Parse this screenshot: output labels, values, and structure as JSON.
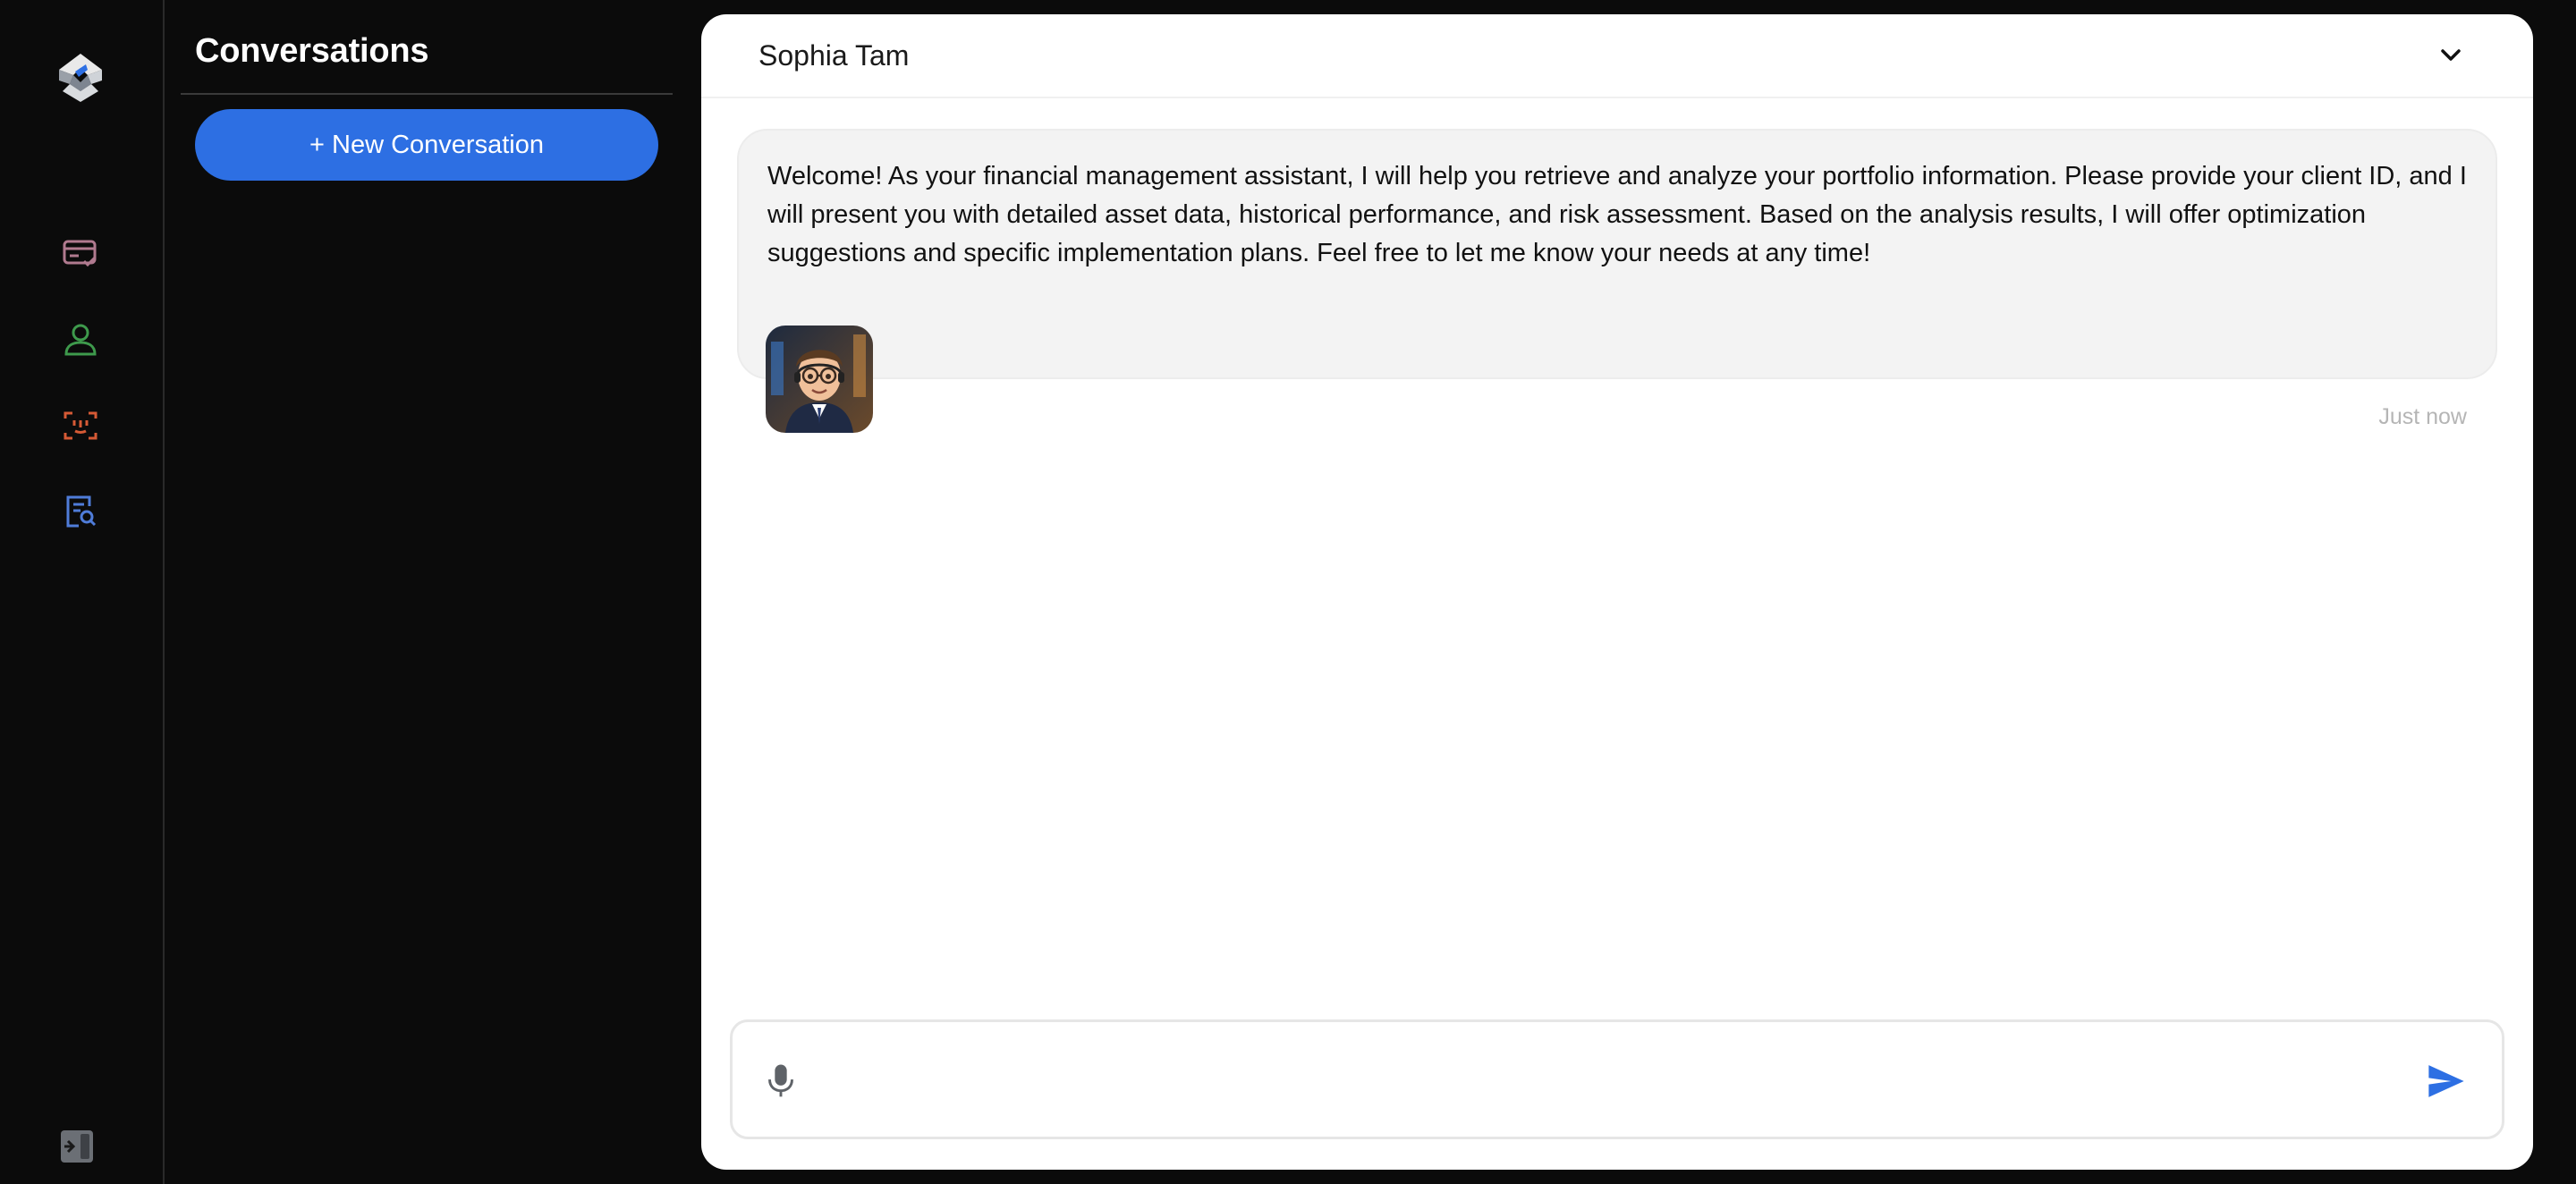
{
  "sidebar": {
    "logo_icon": "brand-logo-icon",
    "nav_items": [
      {
        "icon": "billing-card-check-icon",
        "color": "#b07a8f"
      },
      {
        "icon": "user-profile-icon",
        "color": "#3e9a4c"
      },
      {
        "icon": "scan-face-icon",
        "color": "#d65a35"
      },
      {
        "icon": "report-search-icon",
        "color": "#4f7cd9"
      }
    ],
    "collapse_icon": "sidebar-toggle-icon"
  },
  "conversations": {
    "title": "Conversations",
    "new_button_label": "+ New Conversation",
    "accent_color": "#2d6fe3"
  },
  "chat": {
    "contact_name": "Sophia Tam",
    "messages": [
      {
        "text": "Welcome! As your financial management assistant, I will help you retrieve and analyze your portfolio information. Please provide your client ID, and I will present you with detailed asset data, historical performance, and risk assessment. Based on the analysis results, I will offer optimization suggestions and specific implementation plans. Feel free to let me know your needs at any time!",
        "timestamp": "Just now",
        "avatar": "assistant-avatar"
      }
    ],
    "input": {
      "value": "",
      "placeholder": ""
    },
    "send_color": "#2d6fe3"
  }
}
